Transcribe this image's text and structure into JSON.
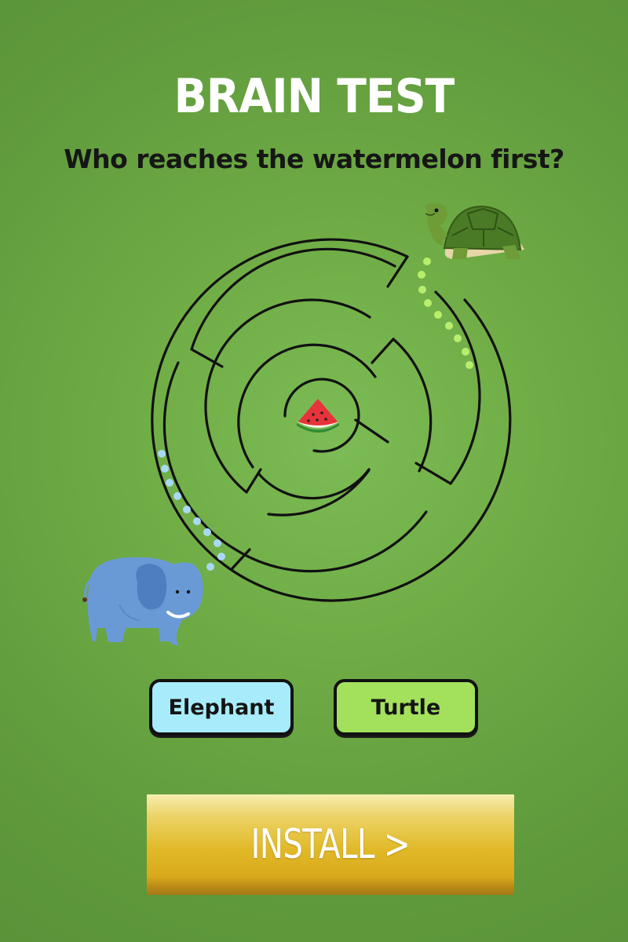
{
  "game": {
    "title": "BRAIN TEST",
    "question": "Who reaches the watermelon first?"
  },
  "characters": {
    "elephant": {
      "icon": "elephant-icon",
      "path_color": "#a9d8f5"
    },
    "turtle": {
      "icon": "turtle-icon",
      "path_color": "#b7ee6e"
    },
    "goal": {
      "icon": "watermelon-icon"
    }
  },
  "answers": {
    "option_1": "Elephant",
    "option_2": "Turtle",
    "option_1_color": "#a8ecfb",
    "option_2_color": "#a3e15c"
  },
  "cta": {
    "label": "INSTALL >"
  }
}
